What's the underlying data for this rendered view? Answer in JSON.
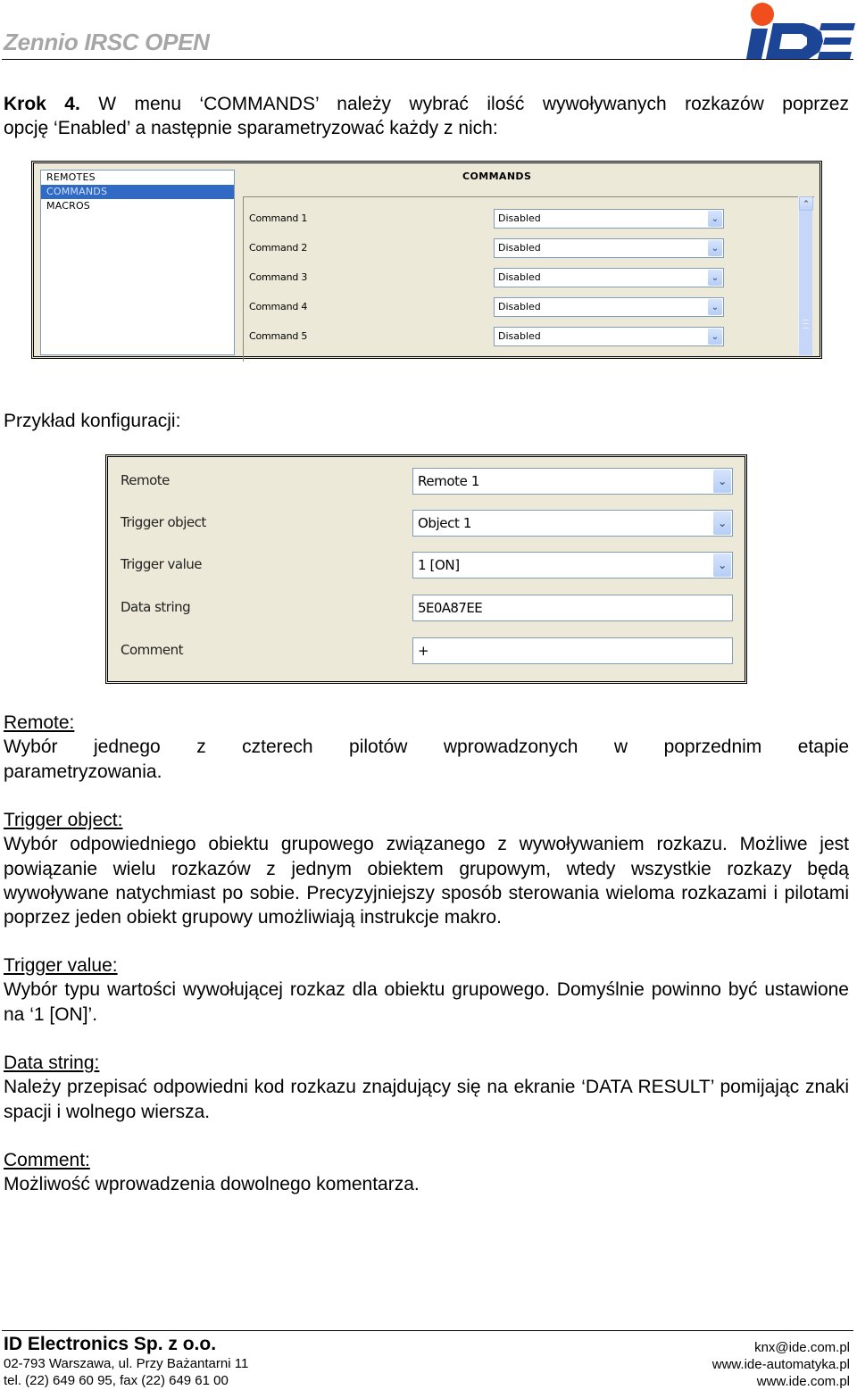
{
  "header": {
    "title": "Zennio IRSC OPEN",
    "logo": {
      "icon": "ide-logo-icon",
      "text": "iDE",
      "colors": {
        "blue": "#1c4595",
        "orange": "#f04e1c"
      }
    }
  },
  "intro": {
    "step_label": "Krok 4.",
    "line1": "W menu ‘COMMANDS’ należy wybrać ilość wywoływanych rozkazów poprzez",
    "line2": "opcję ‘Enabled’ a następnie sparametryzować każdy z nich:"
  },
  "commands_window": {
    "tree_items": [
      {
        "label": "REMOTES",
        "selected": false
      },
      {
        "label": "COMMANDS",
        "selected": true
      },
      {
        "label": "MACROS",
        "selected": false
      }
    ],
    "panel_title": "COMMANDS",
    "rows": [
      {
        "label": "Command 1",
        "value": "Disabled"
      },
      {
        "label": "Command 2",
        "value": "Disabled"
      },
      {
        "label": "Command 3",
        "value": "Disabled"
      },
      {
        "label": "Command 4",
        "value": "Disabled"
      },
      {
        "label": "Command 5",
        "value": "Disabled"
      }
    ],
    "dropdown_icon": "chevron-down-icon",
    "scroll_up_icon": "chevron-up-icon"
  },
  "example_label": "Przykład konfiguracji:",
  "config_window": {
    "rows": [
      {
        "label": "Remote",
        "value": "Remote 1",
        "type": "dropdown"
      },
      {
        "label": "Trigger object",
        "value": "Object 1",
        "type": "dropdown"
      },
      {
        "label": "Trigger value",
        "value": "1 [ON]",
        "type": "dropdown"
      },
      {
        "label": "Data string",
        "value": "5E0A87EE",
        "type": "text"
      },
      {
        "label": "Comment",
        "value": "+",
        "type": "text"
      }
    ]
  },
  "sections": [
    {
      "heading": "Remote:",
      "body_justified": "Wybór jednego z czterech pilotów wprowadzonych w poprzednim etapie",
      "body_rest": "parametryzowania."
    },
    {
      "heading": "Trigger object:",
      "body": "Wybór odpowiedniego obiektu grupowego związanego z wywoływaniem rozkazu. Możliwe jest powiązanie wielu rozkazów z jednym obiektem grupowym, wtedy wszystkie rozkazy będą wywoływane natychmiast po sobie. Precyzyjniejszy sposób sterowania wieloma rozkazami i pilotami poprzez jeden obiekt grupowy umożliwiają instrukcje makro."
    },
    {
      "heading": "Trigger value:",
      "body": "Wybór typu wartości wywołującej rozkaz dla obiektu grupowego. Domyślnie powinno być ustawione na ‘1 [ON]’."
    },
    {
      "heading": "Data string:",
      "body": "Należy przepisać odpowiedni kod rozkazu znajdujący się na ekranie ‘DATA RESULT’ pomijając znaki spacji i wolnego wiersza."
    },
    {
      "heading": "Comment:",
      "body": "Możliwość wprowadzenia dowolnego komentarza."
    }
  ],
  "footer": {
    "company": "ID Electronics Sp. z o.o.",
    "address": "02-793 Warszawa, ul. Przy Bażantarni 11",
    "phone": "tel. (22) 649 60 95, fax (22) 649 61 00",
    "email": "knx@ide.com.pl",
    "website1": "www.ide-automatyka.pl",
    "website2": "www.ide.com.pl"
  }
}
